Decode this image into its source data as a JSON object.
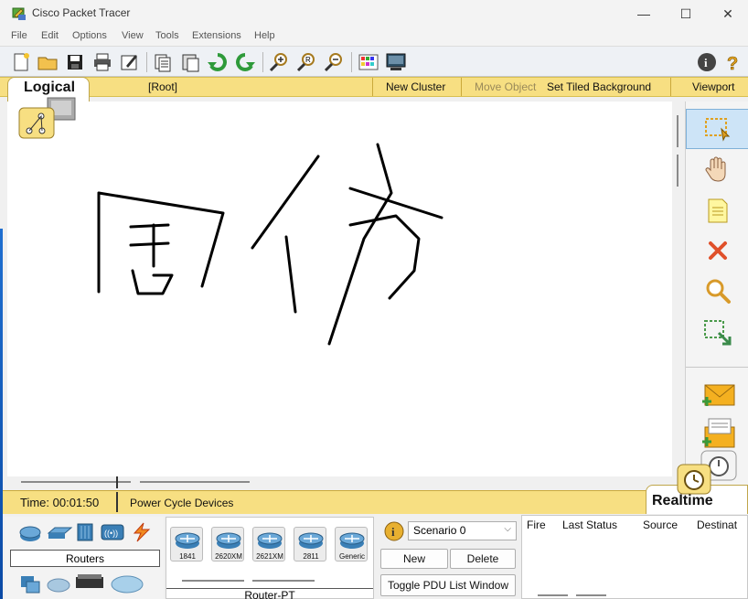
{
  "window": {
    "title": "Cisco Packet Tracer",
    "minimize": "—",
    "maximize": "☐",
    "close": "✕"
  },
  "menu": [
    "File",
    "Edit",
    "Options",
    "View",
    "Tools",
    "Extensions",
    "Help"
  ],
  "nav": {
    "logical": "Logical",
    "root": "[Root]",
    "new_cluster": "New Cluster",
    "move_object": "Move Object",
    "set_tiled_background": "Set Tiled Background",
    "viewport": "Viewport"
  },
  "status": {
    "time_label": "Time: 00:01:50",
    "power_cycle": "Power Cycle Devices",
    "mode": "Realtime"
  },
  "device_panel": {
    "category": "Routers",
    "models": [
      "1841",
      "2620XM",
      "2621XM",
      "2811",
      "Generic"
    ],
    "selected_model_name": "Router-PT"
  },
  "scenario": {
    "selected": "Scenario 0",
    "new_button": "New",
    "delete_button": "Delete",
    "toggle_button": "Toggle PDU List Window",
    "info_icon": "i"
  },
  "pdu_table": {
    "columns": [
      "Fire",
      "Last Status",
      "Source",
      "Destinat"
    ]
  },
  "colors": {
    "nav_yellow": "#f7df82",
    "router_blue": "#3a7fb6",
    "red_x": "#e0502a"
  }
}
